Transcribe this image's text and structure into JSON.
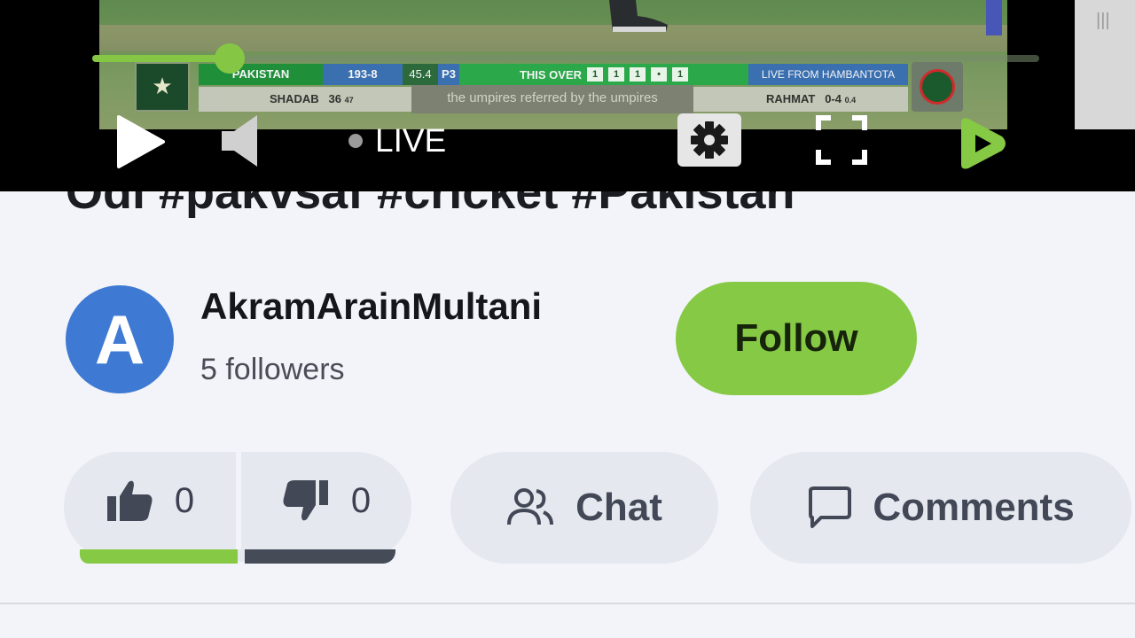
{
  "player": {
    "live_label": "LIVE",
    "progress_fraction": 0.145,
    "scorebug": {
      "team": "PAKISTAN",
      "score": "193-8",
      "overs": "45.4",
      "powerplay": "P3",
      "this_over_label": "THIS OVER",
      "this_over_balls": [
        "1",
        "1",
        "1",
        "•",
        "1"
      ],
      "live_from": "LIVE FROM HAMBANTOTA",
      "batter_name": "SHADAB",
      "batter_runs": "36",
      "batter_balls": "47",
      "bowler_name": "RAHMAT",
      "bowler_figures": "0-4",
      "bowler_overs": "0.4",
      "caption": "the umpires referred by the umpires"
    }
  },
  "video": {
    "title_partial": "Odi #pakvsaf #cricket #Pakistan"
  },
  "channel": {
    "avatar_letter": "A",
    "name": "AkramArainMultani",
    "followers": "5 followers",
    "follow_label": "Follow"
  },
  "actions": {
    "likes": "0",
    "dislikes": "0",
    "chat_label": "Chat",
    "comments_label": "Comments"
  },
  "colors": {
    "accent_green": "#86c944",
    "avatar_blue": "#3e7ad3",
    "dislike_bar": "#454b57"
  },
  "icons": [
    "play-icon",
    "volume-icon",
    "gear-icon",
    "fullscreen-icon",
    "rumble-logo-icon",
    "thumbs-up-icon",
    "thumbs-down-icon",
    "people-icon",
    "comment-icon"
  ]
}
